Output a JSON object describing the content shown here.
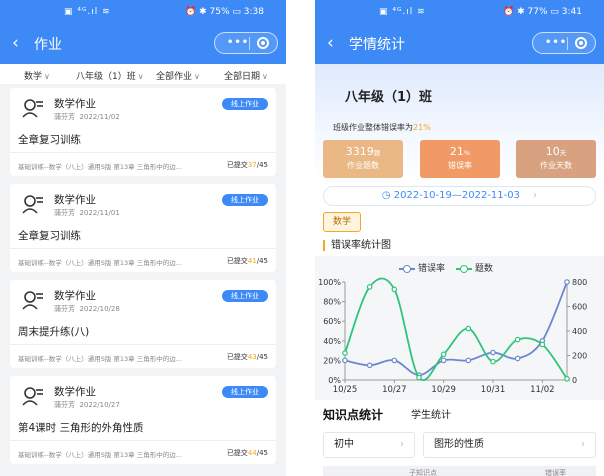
{
  "status_left": {
    "icons": "▣ ⁴ᴳ.ıl ≋",
    "right": "⏰ ✱ 75% ▭ 3:38"
  },
  "status_right": {
    "icons": "▣ ⁴ᴳ.ıl ≋",
    "right": "⏰ ✱ 77% ▭ 3:41"
  },
  "left": {
    "title": "作业",
    "filters": [
      {
        "label": "数学"
      },
      {
        "label": "八年级（1）班"
      },
      {
        "label": "全部作业"
      },
      {
        "label": "全部日期"
      }
    ],
    "cards": [
      {
        "subject": "数学作业",
        "teacher": "蒲芬芳",
        "date": "2022/11/02",
        "badge": "线上作业",
        "title": "全章复习训练",
        "desc": "基础训练--数学（八上）通用S版 第13章 三角形中的边...",
        "submitted_label": "已提交",
        "submitted": "37",
        "total": "/45"
      },
      {
        "subject": "数学作业",
        "teacher": "蒲芬芳",
        "date": "2022/11/01",
        "badge": "线上作业",
        "title": "全章复习训练",
        "desc": "基础训练--数学（八上）通用S版 第13章 三角形中的边...",
        "submitted_label": "已提交",
        "submitted": "41",
        "total": "/45"
      },
      {
        "subject": "数学作业",
        "teacher": "蒲芬芳",
        "date": "2022/10/28",
        "badge": "线上作业",
        "title": "周末提升练(八)",
        "desc": "基础训练--数学（八上）通用S版 第13章 三角形中的边...",
        "submitted_label": "已提交",
        "submitted": "43",
        "total": "/45"
      },
      {
        "subject": "数学作业",
        "teacher": "蒲芬芳",
        "date": "2022/10/27",
        "badge": "线上作业",
        "title": "第4课时 三角形的外角性质",
        "desc": "基础训练--数学（八上）通用S版 第13章 三角形中的边...",
        "submitted_label": "已提交",
        "submitted": "44",
        "total": "/45"
      }
    ]
  },
  "right": {
    "title": "学情统计",
    "class_title": "八年级（1）班",
    "error_prefix": "班级作业整体错误率为",
    "error_rate": "21%",
    "stats": [
      {
        "value": "3319",
        "unit": "题",
        "label": "作业题数",
        "color": "#e9b884"
      },
      {
        "value": "21",
        "unit": "%",
        "label": "错误率",
        "color": "#f29a66"
      },
      {
        "value": "10",
        "unit": "天",
        "label": "作业天数",
        "color": "#d8a17f"
      }
    ],
    "date_range": "2022-10-19—2022-11-03",
    "subject_tag": "数学",
    "section_title": "错误率统计图",
    "legend": {
      "error_rate": "错误率",
      "count": "题数"
    },
    "tabs": {
      "active": "知识点统计",
      "other": "学生统计"
    },
    "dropdowns": [
      {
        "label": "初中"
      },
      {
        "label": "图形的性质"
      }
    ],
    "table_headers": {
      "left": "子知识点",
      "right": "错误率"
    }
  },
  "chart_data": {
    "type": "line",
    "x": [
      "10/25",
      "10/26",
      "10/27",
      "10/28",
      "10/29",
      "10/30",
      "10/31",
      "11/01",
      "11/02",
      "11/03"
    ],
    "x_tick_labels": [
      "10/25",
      "10/27",
      "10/29",
      "10/31",
      "11/02"
    ],
    "series": [
      {
        "name": "错误率",
        "axis": "left",
        "color": "#6a89cc",
        "values": [
          20,
          15,
          20,
          5,
          20,
          20,
          28,
          22,
          40,
          100
        ]
      },
      {
        "name": "题数",
        "axis": "right",
        "color": "#2ec47a",
        "values": [
          220,
          760,
          740,
          20,
          210,
          420,
          150,
          330,
          290,
          10
        ]
      }
    ],
    "y_left": {
      "ticks": [
        "0%",
        "20%",
        "40%",
        "60%",
        "80%",
        "100%"
      ],
      "ylim": [
        0,
        100
      ]
    },
    "y_right": {
      "ticks": [
        "0",
        "200",
        "400",
        "600",
        "800"
      ],
      "ylim": [
        0,
        800
      ]
    },
    "legend_position": "top-center"
  }
}
